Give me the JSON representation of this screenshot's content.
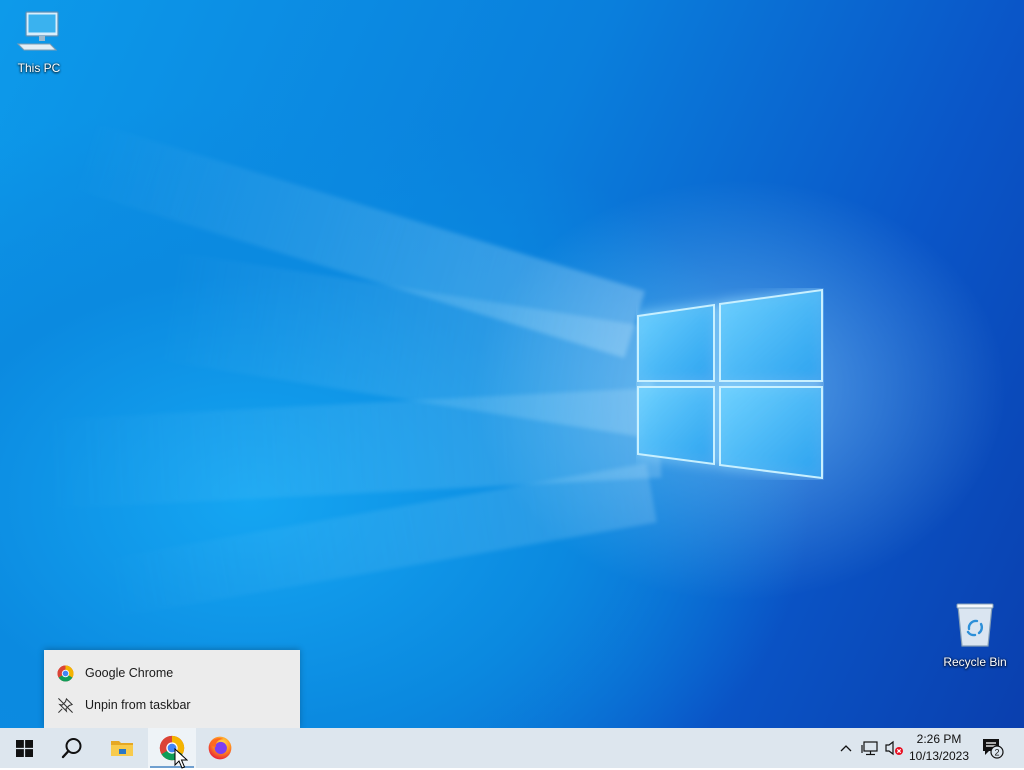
{
  "desktop": {
    "icons": [
      {
        "label": "This PC",
        "icon": "computer-icon"
      },
      {
        "label": "Recycle Bin",
        "icon": "recycle-bin-icon"
      }
    ],
    "wallpaper": "windows-10-hero"
  },
  "context_menu": {
    "items": [
      {
        "label": "Google Chrome",
        "icon": "chrome-icon"
      },
      {
        "label": "Unpin from taskbar",
        "icon": "unpin-icon"
      }
    ]
  },
  "taskbar": {
    "buttons": [
      {
        "name": "start",
        "icon": "windows-logo-icon"
      },
      {
        "name": "search",
        "icon": "search-icon"
      },
      {
        "name": "file-explorer",
        "icon": "folder-icon"
      },
      {
        "name": "google-chrome",
        "icon": "chrome-icon",
        "active": true
      },
      {
        "name": "firefox",
        "icon": "firefox-icon"
      }
    ],
    "tray": {
      "time": "2:26 PM",
      "date": "10/13/2023",
      "notification_count": "2"
    }
  },
  "colors": {
    "taskbar_bg": "#dde6ee",
    "menu_bg": "#ececec",
    "wallpaper_blue": "#0a7fdc"
  }
}
